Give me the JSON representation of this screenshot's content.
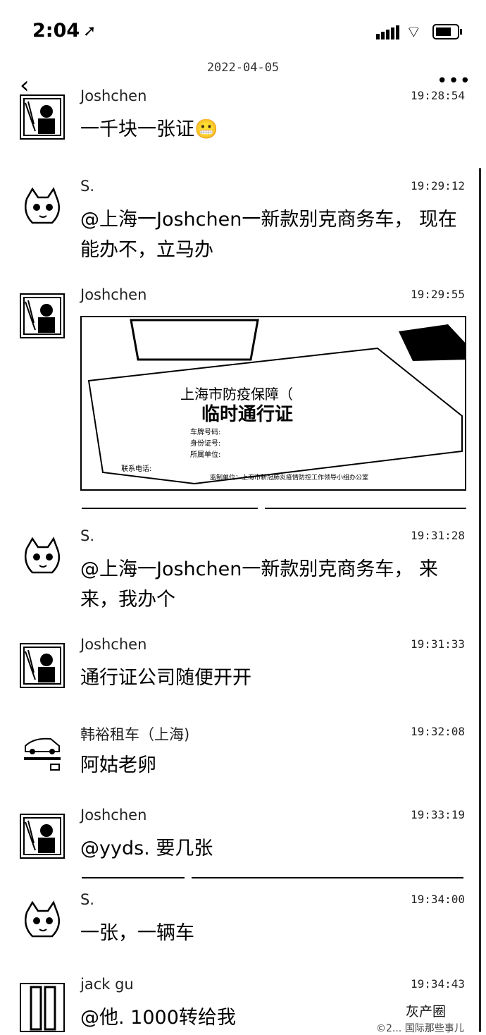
{
  "status_bar": {
    "time": "2:04",
    "location_icon": "location-arrow-icon",
    "battery_level": 0.75
  },
  "header": {
    "date": "2022-04-05",
    "back_icon": "chevron-left-icon",
    "more_icon": "more-dots-icon"
  },
  "messages": [
    {
      "name": "Joshchen",
      "time": "19:28:54",
      "text": "一千块一张证😬",
      "avatar": "man-sunglasses-avatar"
    },
    {
      "name": "S.",
      "time": "19:29:12",
      "text": "@上海一Joshchen一新款别克商务车， 现在能办不，立马办",
      "avatar": "cartoon-cat-avatar"
    },
    {
      "name": "Joshchen",
      "time": "19:29:55",
      "text": "",
      "avatar": "man-sunglasses-avatar"
    },
    {
      "name": "S.",
      "time": "19:31:28",
      "text": "@上海一Joshchen一新款别克商务车， 来来，我办个",
      "avatar": "cartoon-cat-avatar"
    },
    {
      "name": "Joshchen",
      "time": "19:31:33",
      "text": "通行证公司随便开开",
      "avatar": "man-sunglasses-avatar"
    },
    {
      "name": "韩裕租车（上海)",
      "time": "19:32:08",
      "text": "阿姑老卵",
      "avatar": "rental-car-logo-avatar"
    },
    {
      "name": "Joshchen",
      "time": "19:33:19",
      "text": "@yyds. 要几张",
      "avatar": "man-sunglasses-avatar"
    },
    {
      "name": "S.",
      "time": "19:34:00",
      "text": "一张，一辆车",
      "avatar": "cartoon-cat-avatar"
    },
    {
      "name": "jack gu",
      "time": "19:34:43",
      "text": "@他. 1000转给我",
      "avatar": "door-avatar"
    }
  ],
  "photo": {
    "title": "上海市防疫保障（",
    "subtitle": "临时通行证",
    "fields": [
      "车牌号码:",
      "身份证号:",
      "所属单位:"
    ],
    "phone_label": "联系电话:",
    "issuer": "监制单位：上海市新冠肺炎疫情防控工作领导小组办公室"
  },
  "watermark": {
    "brand": "灰产圈",
    "sub": "©2... 国际那些事儿"
  }
}
